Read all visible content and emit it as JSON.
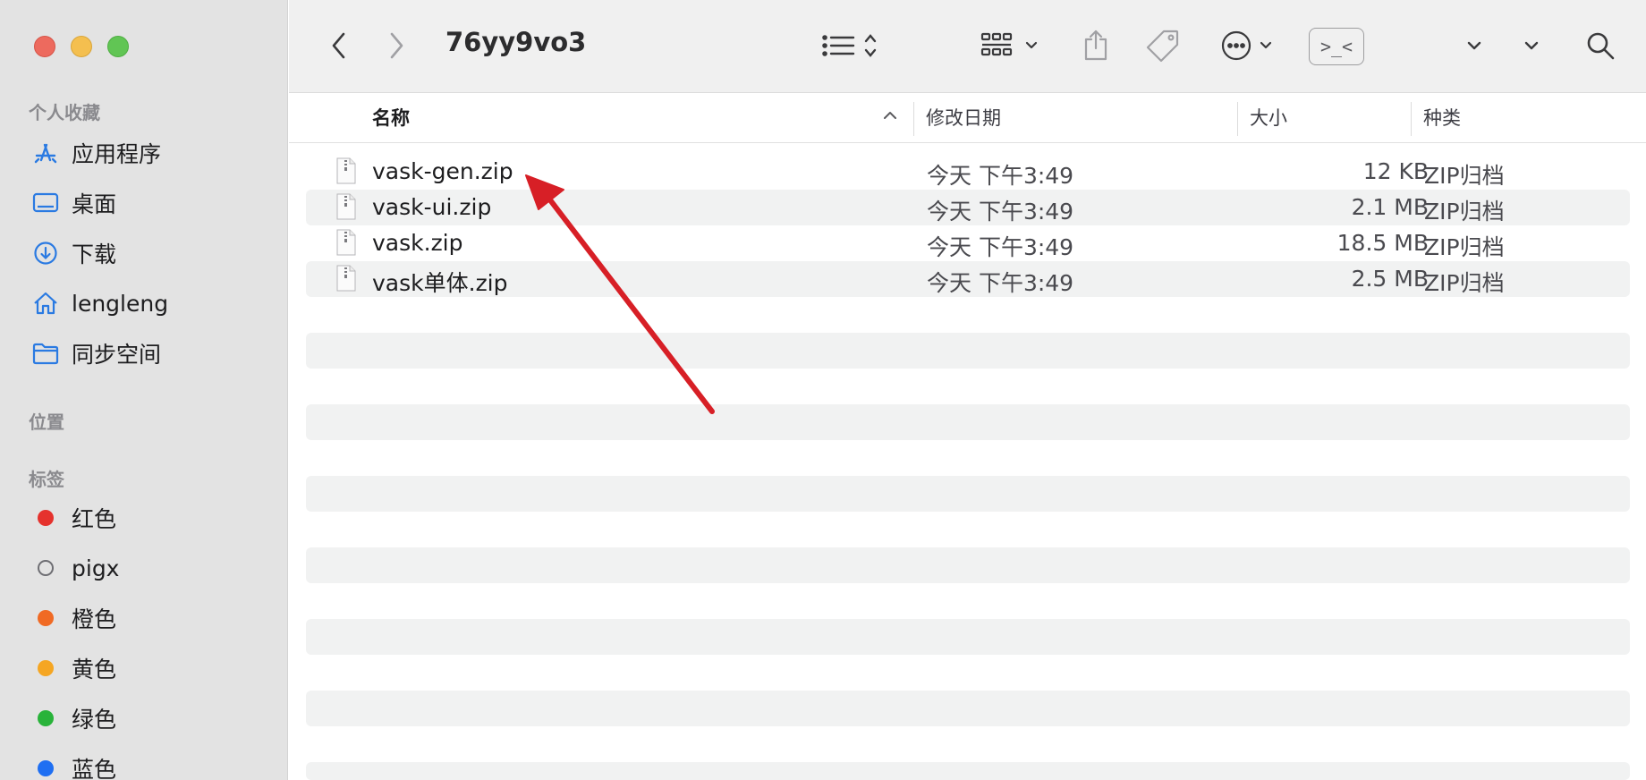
{
  "window": {
    "title": "76yy9vo3"
  },
  "sidebar": {
    "favorites_title": "个人收藏",
    "favorites": [
      {
        "label": "应用程序",
        "icon": "apps-icon"
      },
      {
        "label": "桌面",
        "icon": "desktop-icon"
      },
      {
        "label": "下载",
        "icon": "download-icon"
      },
      {
        "label": "lengleng",
        "icon": "home-icon"
      },
      {
        "label": "同步空间",
        "icon": "folder-icon"
      }
    ],
    "locations_title": "位置",
    "tags_title": "标签",
    "tags": [
      {
        "label": "红色",
        "color": "#e5322d"
      },
      {
        "label": "pigx",
        "color": ""
      },
      {
        "label": "橙色",
        "color": "#f06a24"
      },
      {
        "label": "黄色",
        "color": "#f5a623"
      },
      {
        "label": "绿色",
        "color": "#29b33a"
      },
      {
        "label": "蓝色",
        "color": "#1f6ff2"
      }
    ]
  },
  "toolbar": {
    "term_label": ">_<"
  },
  "columns": {
    "name": "名称",
    "date": "修改日期",
    "size": "大小",
    "kind": "种类"
  },
  "files": [
    {
      "name": "vask-gen.zip",
      "date": "今天 下午3:49",
      "size": "12 KB",
      "kind": "ZIP归档"
    },
    {
      "name": "vask-ui.zip",
      "date": "今天 下午3:49",
      "size": "2.1 MB",
      "kind": "ZIP归档"
    },
    {
      "name": "vask.zip",
      "date": "今天 下午3:49",
      "size": "18.5 MB",
      "kind": "ZIP归档"
    },
    {
      "name": "vask单体.zip",
      "date": "今天 下午3:49",
      "size": "2.5 MB",
      "kind": "ZIP归档"
    }
  ],
  "colors": {
    "annotation_arrow": "#d71f26",
    "sidebar_bg": "#e3e3e3",
    "stripe": "#f1f2f2"
  }
}
